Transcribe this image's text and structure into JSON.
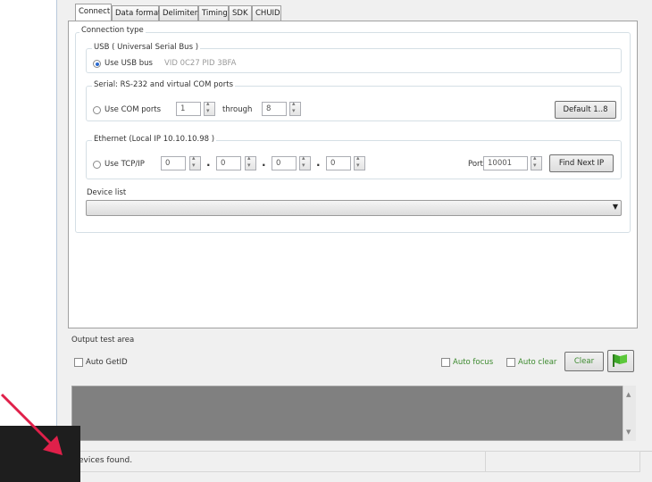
{
  "tabs": [
    "Connect",
    "Data format",
    "Delimiters",
    "Timing",
    "SDK",
    "CHUID"
  ],
  "active_tab": "Connect",
  "connection_type_label": "Connection type",
  "usb": {
    "group_label": "USB ( Universal Serial Bus )",
    "radio_label": "Use USB bus",
    "selected": true,
    "device_info": "VID 0C27 PID 3BFA"
  },
  "serial": {
    "group_label": "Serial: RS-232 and virtual COM ports",
    "radio_label": "Use COM ports",
    "from_value": "1",
    "through_label": "through",
    "to_value": "8",
    "default_button": "Default 1..8"
  },
  "ethernet": {
    "group_label": "Ethernet (Local IP 10.10.10.98 )",
    "radio_label": "Use TCP/IP",
    "ip": [
      "0",
      "0",
      "0",
      "0"
    ],
    "port_label": "Port",
    "port_value": "10001",
    "find_button": "Find Next IP"
  },
  "device_list_label": "Device list",
  "output": {
    "label": "Output test area",
    "auto_getid": "Auto GetID",
    "auto_focus": "Auto focus",
    "auto_clear": "Auto clear",
    "clear_button": "Clear"
  },
  "status_text": "evices found.",
  "colors": {
    "green_text": "#3c8a2e",
    "arrow": "#e0204a",
    "output_area": "#808080"
  },
  "icons": {
    "flag_button": "green-flag-icon",
    "arrow": "red-arrow-icon"
  }
}
